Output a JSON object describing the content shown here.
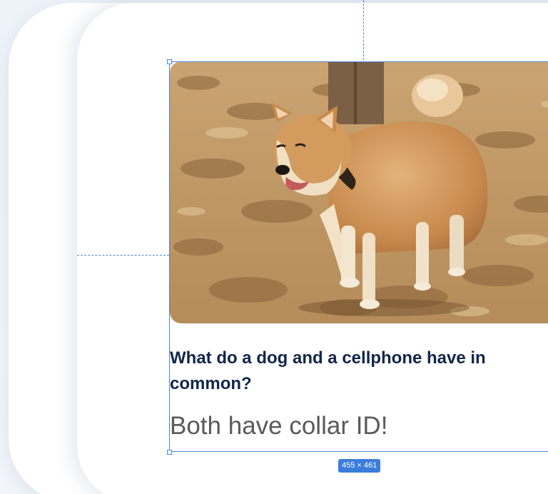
{
  "post": {
    "question": "What do a dog and a cellphone have in common?",
    "answer": "Both have collar ID!"
  },
  "image": {
    "subject": "dog on sand beach"
  },
  "selection": {
    "dimensions_label": "455 × 461"
  },
  "colors": {
    "background": "#eef3f9",
    "card": "#ffffff",
    "guide": "#4a86d9",
    "badge": "#3b7ddb",
    "question_text": "#12264a",
    "answer_text": "#5a5a5a"
  }
}
